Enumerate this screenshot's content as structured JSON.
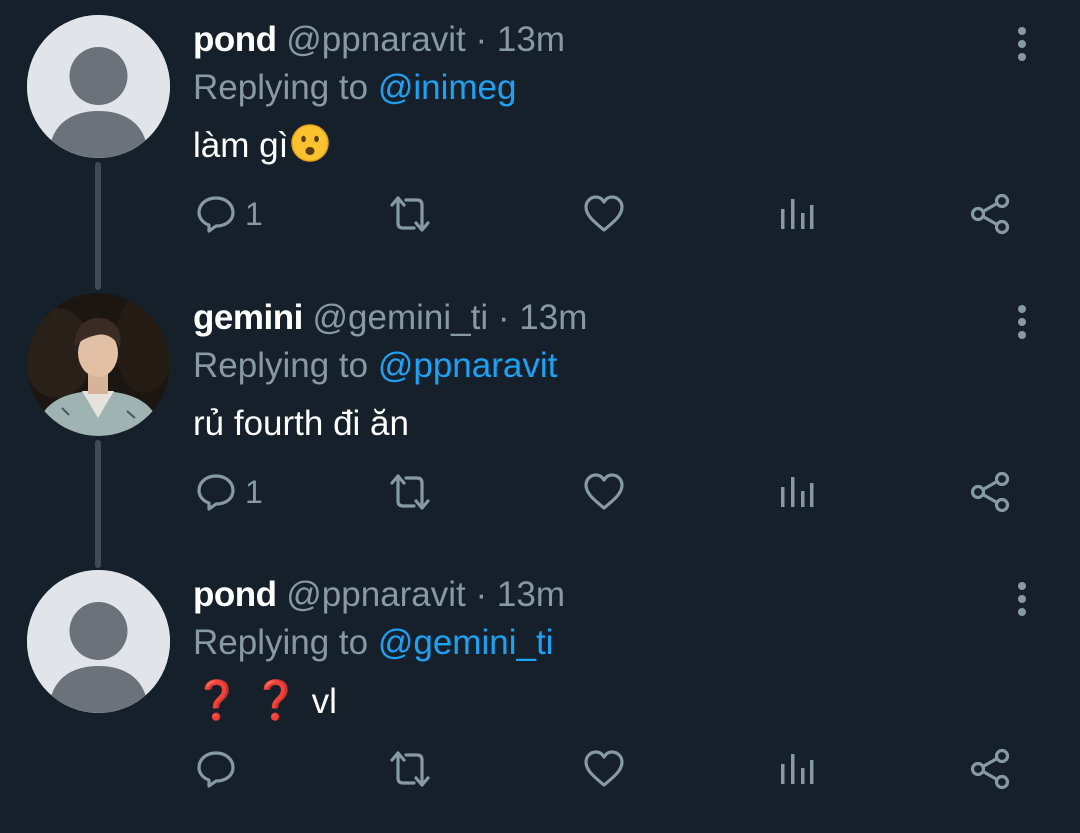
{
  "colors": {
    "background": "#15202b",
    "secondary_text": "#8899a6",
    "mention_blue": "#1da1f2",
    "thread_line": "#3d4a57"
  },
  "tweets": [
    {
      "name": "pond",
      "handle": "@ppnaravit",
      "separator": "·",
      "time": "13m",
      "replying_prefix": "Replying to",
      "replying_to": "@inimeg",
      "text": "làm gì",
      "emoji": "frowning-face-with-open-mouth",
      "reply_count": "1",
      "avatar": "default-avatar"
    },
    {
      "name": "gemini",
      "handle": "@gemini_ti",
      "separator": "·",
      "time": "13m",
      "replying_prefix": "Replying to",
      "replying_to": "@ppnaravit",
      "text": "rủ fourth đi ăn",
      "reply_count": "1",
      "avatar": "profile-photo"
    },
    {
      "name": "pond",
      "handle": "@ppnaravit",
      "separator": "·",
      "time": "13m",
      "replying_prefix": "Replying to",
      "replying_to": "@gemini_ti",
      "qmarks": [
        "❓",
        "❓"
      ],
      "text": "vl",
      "reply_count": "",
      "avatar": "default-avatar"
    }
  ]
}
